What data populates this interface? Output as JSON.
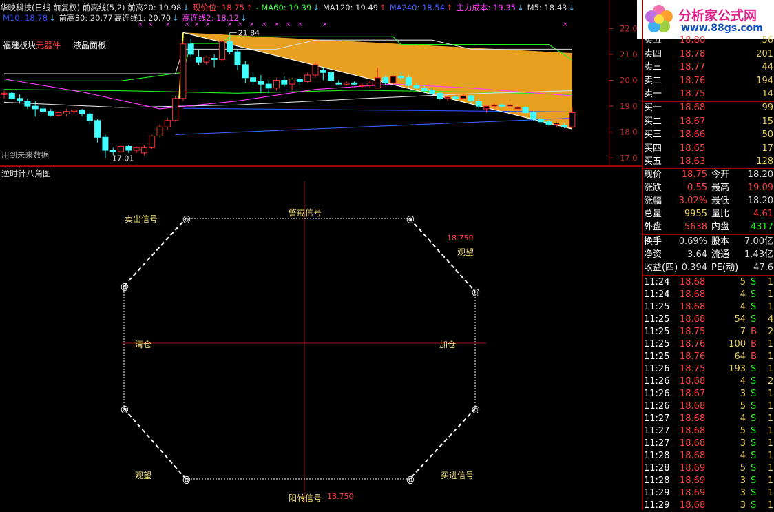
{
  "header": {
    "row1": [
      {
        "text": "华映科技(日线 前复权) 前高线(5,2) 前高20: 19.98",
        "color": "#dddddd"
      },
      {
        "text": "↓",
        "color": "#5fc8ff"
      },
      {
        "text": "现价位: 18.75",
        "color": "#ff4040"
      },
      {
        "text": "↑",
        "color": "#ff4040"
      },
      {
        "text": "- MA60: 19.39",
        "color": "#40ff40"
      },
      {
        "text": "↓",
        "color": "#5fc8ff"
      },
      {
        "text": "MA120: 19.49",
        "color": "#dddddd"
      },
      {
        "text": "↑",
        "color": "#ff4040"
      },
      {
        "text": "MA240: 18.54",
        "color": "#4060ff"
      },
      {
        "text": "↑",
        "color": "#ff4040"
      },
      {
        "text": "主力成本: 19.35",
        "color": "#ff40ff"
      },
      {
        "text": "↓",
        "color": "#5fc8ff"
      },
      {
        "text": "M5: 18.43",
        "color": "#dddddd"
      },
      {
        "text": "↓",
        "color": "#5fc8ff"
      }
    ],
    "row2": [
      {
        "text": "M10: 18.78",
        "color": "#3050ff"
      },
      {
        "text": "↓",
        "color": "#5fc8ff"
      },
      {
        "text": "前高30: 20.77",
        "color": "#dddddd"
      },
      {
        "text": "高连线1: 20.70",
        "color": "#dddddd"
      },
      {
        "text": "↓",
        "color": "#5fc8ff"
      },
      {
        "text": "高连线2: 18.12",
        "color": "#ff40ff"
      },
      {
        "text": "↓",
        "color": "#5fc8ff"
      }
    ],
    "label_block": "福建板块",
    "label_sector": "元器件",
    "label_panel": "液晶面板",
    "label_future": "用到未来数据",
    "high_annotation": "21.84",
    "low_annotation": "17.01",
    "marker_char": "×"
  },
  "logo": {
    "title": "分析家公式网",
    "url": "www.88gs.com"
  },
  "chart_data": [
    {
      "type": "candlestick",
      "title": "",
      "ylim": [
        16.85,
        22.3
      ],
      "y_ticks": [
        "22.00",
        "21.00",
        "20.00",
        "19.00",
        "18.00",
        "17.00"
      ],
      "y_tick_values": [
        22,
        21,
        20,
        19,
        18,
        17
      ],
      "candles": [
        [
          19.45,
          19.6,
          19.3,
          19.5
        ],
        [
          19.5,
          19.55,
          19.25,
          19.3
        ],
        [
          19.3,
          19.45,
          19.1,
          19.2
        ],
        [
          19.2,
          19.3,
          18.9,
          19.0
        ],
        [
          19.0,
          19.2,
          18.6,
          18.9
        ],
        [
          18.9,
          19.0,
          18.7,
          18.8
        ],
        [
          18.8,
          18.9,
          18.6,
          18.65
        ],
        [
          18.65,
          18.8,
          18.6,
          18.75
        ],
        [
          18.7,
          18.9,
          18.6,
          18.8
        ],
        [
          18.8,
          18.9,
          18.7,
          18.85
        ],
        [
          18.85,
          18.9,
          18.6,
          18.7
        ],
        [
          18.7,
          18.8,
          18.3,
          18.45
        ],
        [
          18.45,
          18.5,
          17.6,
          17.8
        ],
        [
          17.8,
          17.9,
          17.0,
          17.3
        ],
        [
          17.3,
          17.4,
          17.1,
          17.25
        ],
        [
          17.25,
          17.5,
          17.2,
          17.45
        ],
        [
          17.45,
          17.5,
          17.2,
          17.3
        ],
        [
          17.3,
          17.45,
          17.2,
          17.4
        ],
        [
          17.2,
          17.5,
          17.1,
          17.4
        ],
        [
          17.4,
          17.9,
          17.35,
          17.85
        ],
        [
          17.85,
          18.3,
          17.8,
          18.2
        ],
        [
          18.2,
          18.55,
          18.1,
          18.45
        ],
        [
          18.45,
          19.4,
          18.4,
          19.3
        ],
        [
          19.3,
          21.5,
          19.2,
          21.4
        ],
        [
          21.4,
          21.6,
          20.9,
          21.0
        ],
        [
          20.9,
          21.2,
          20.6,
          20.7
        ],
        [
          20.7,
          20.95,
          20.6,
          20.9
        ],
        [
          20.85,
          21.0,
          20.5,
          20.8
        ],
        [
          20.8,
          21.6,
          20.7,
          21.5
        ],
        [
          21.5,
          21.84,
          21.0,
          21.1
        ],
        [
          21.1,
          21.2,
          20.4,
          20.6
        ],
        [
          20.6,
          20.75,
          19.9,
          20.1
        ],
        [
          20.1,
          20.3,
          19.8,
          19.95
        ],
        [
          19.95,
          20.2,
          19.5,
          19.85
        ],
        [
          19.85,
          20.0,
          19.5,
          19.7
        ],
        [
          19.7,
          20.1,
          19.6,
          20.0
        ],
        [
          20.0,
          20.15,
          19.75,
          19.85
        ],
        [
          19.85,
          20.1,
          19.6,
          20.05
        ],
        [
          20.05,
          20.1,
          19.8,
          19.95
        ],
        [
          19.95,
          20.3,
          19.9,
          20.2
        ],
        [
          20.2,
          20.7,
          20.1,
          20.6
        ],
        [
          20.4,
          20.5,
          20.0,
          20.3
        ],
        [
          20.3,
          20.35,
          19.9,
          20.0
        ],
        [
          19.9,
          20.0,
          19.8,
          19.85
        ],
        [
          19.85,
          19.95,
          19.8,
          19.9
        ],
        [
          19.9,
          19.95,
          19.8,
          19.85
        ],
        [
          19.8,
          19.9,
          19.7,
          19.8
        ],
        [
          19.8,
          20.0,
          19.7,
          19.9
        ],
        [
          19.7,
          20.5,
          19.7,
          20.1
        ],
        [
          20.1,
          20.2,
          19.8,
          19.9
        ],
        [
          19.9,
          20.2,
          19.8,
          20.15
        ],
        [
          20.15,
          20.3,
          20.0,
          20.1
        ],
        [
          20.1,
          20.2,
          19.7,
          19.8
        ],
        [
          19.8,
          19.9,
          19.65,
          19.7
        ],
        [
          19.7,
          19.8,
          19.5,
          19.6
        ],
        [
          19.6,
          19.7,
          19.4,
          19.5
        ],
        [
          19.5,
          19.55,
          19.25,
          19.3
        ],
        [
          19.3,
          19.4,
          19.2,
          19.35
        ],
        [
          19.35,
          19.4,
          19.25,
          19.3
        ],
        [
          19.3,
          19.45,
          19.25,
          19.4
        ],
        [
          19.4,
          19.45,
          19.1,
          19.2
        ],
        [
          19.2,
          19.3,
          18.9,
          19.0
        ],
        [
          18.9,
          19.05,
          18.75,
          19.0
        ],
        [
          19.0,
          19.1,
          18.9,
          19.05
        ],
        [
          19.05,
          19.1,
          18.95,
          19.0
        ],
        [
          19.0,
          19.1,
          18.9,
          19.05
        ],
        [
          18.9,
          19.0,
          18.9,
          18.95
        ],
        [
          18.95,
          19.0,
          18.7,
          18.75
        ],
        [
          18.75,
          18.8,
          18.45,
          18.5
        ],
        [
          18.5,
          18.55,
          18.3,
          18.4
        ],
        [
          18.4,
          18.45,
          18.25,
          18.3
        ],
        [
          18.3,
          18.4,
          18.2,
          18.35
        ],
        [
          18.25,
          18.35,
          18.15,
          18.2
        ],
        [
          18.2,
          18.95,
          18.15,
          18.75
        ]
      ],
      "lines": [
        {
          "name": "前高20",
          "color": "#22ee22",
          "values": [
            [
              0,
              19.98
            ],
            [
              15,
              19.98
            ],
            [
              23,
              20.3
            ],
            [
              24,
              21.42
            ],
            [
              28,
              21.42
            ],
            [
              29,
              21.68
            ],
            [
              50,
              21.68
            ],
            [
              51,
              21.38
            ],
            [
              70,
              21.38
            ],
            [
              73,
              20.78
            ]
          ]
        },
        {
          "name": "前高30",
          "color": "#dddddd",
          "values": [
            [
              0,
              20.25
            ],
            [
              22,
              20.25
            ],
            [
              23,
              21.2
            ],
            [
              35,
              21.2
            ],
            [
              40,
              21.55
            ],
            [
              55,
              21.55
            ],
            [
              60,
              21.2
            ],
            [
              73,
              21.2
            ]
          ]
        },
        {
          "name": "MA60",
          "color": "#22ee22",
          "values": [
            [
              0,
              19.65
            ],
            [
              15,
              19.6
            ],
            [
              30,
              19.5
            ],
            [
              45,
              19.62
            ],
            [
              60,
              19.55
            ],
            [
              73,
              19.45
            ]
          ]
        },
        {
          "name": "MA120",
          "color": "#dddddd",
          "values": [
            [
              0,
              19.15
            ],
            [
              15,
              18.95
            ],
            [
              30,
              19.05
            ],
            [
              45,
              19.28
            ],
            [
              60,
              19.48
            ],
            [
              73,
              19.6
            ]
          ]
        },
        {
          "name": "主力成本",
          "color": "#ff40ff",
          "values": [
            [
              0,
              20.05
            ],
            [
              10,
              19.55
            ],
            [
              20,
              18.9
            ],
            [
              30,
              19.2
            ],
            [
              40,
              19.65
            ],
            [
              50,
              19.85
            ],
            [
              60,
              19.7
            ],
            [
              73,
              19.4
            ]
          ]
        },
        {
          "name": "MA240",
          "color": "#4060ff",
          "values": [
            [
              22,
              17.9
            ],
            [
              73,
              18.54
            ]
          ]
        },
        {
          "name": "M10",
          "color": "#3050ff",
          "values": [
            [
              23,
              18.92
            ],
            [
              73,
              18.78
            ]
          ]
        },
        {
          "name": "高连线1",
          "color": "#ffffff",
          "values": [
            [
              23,
              21.84
            ],
            [
              73,
              18.12
            ]
          ]
        }
      ],
      "trend_fill": {
        "color": "#e8a020",
        "top": [
          [
            29,
            21.75
          ],
          [
            73,
            21.05
          ]
        ],
        "bottom_from": [
          23,
          21.84
        ],
        "bottom_to": [
          73,
          18.12
        ]
      }
    },
    {
      "type": "octagon-signal",
      "title": "逆时针八角图",
      "labels": {
        "top_left": "卖出信号",
        "top": "警戒信号",
        "right_top": "观望",
        "right": "加仓",
        "bottom_right": "买进信号",
        "bottom": "阳转信号",
        "bottom_left": "观望",
        "left": "清仓"
      },
      "price_right": "18.750",
      "price_bottom": "18.750",
      "vertex_symbol": "@"
    }
  ],
  "quote_panel": {
    "asks": [
      {
        "label": "卖五",
        "price": "18.80",
        "vol": "56"
      },
      {
        "label": "卖四",
        "price": "18.78",
        "vol": "201"
      },
      {
        "label": "卖三",
        "price": "18.77",
        "vol": "44"
      },
      {
        "label": "卖二",
        "price": "18.76",
        "vol": "194"
      },
      {
        "label": "卖一",
        "price": "18.75",
        "vol": "14"
      }
    ],
    "bids": [
      {
        "label": "买一",
        "price": "18.68",
        "vol": "99"
      },
      {
        "label": "买二",
        "price": "18.67",
        "vol": "15"
      },
      {
        "label": "买三",
        "price": "18.66",
        "vol": "50"
      },
      {
        "label": "买四",
        "price": "18.65",
        "vol": "17"
      },
      {
        "label": "买五",
        "price": "18.63",
        "vol": "128"
      }
    ],
    "stats": [
      {
        "l1": "现价",
        "v1": "18.75",
        "c1": "#ff4040",
        "l2": "今开",
        "v2": "18.20",
        "c2": "#dddddd"
      },
      {
        "l1": "涨跌",
        "v1": "0.55",
        "c1": "#ff4040",
        "l2": "最高",
        "v2": "19.09",
        "c2": "#ff4040"
      },
      {
        "l1": "涨幅",
        "v1": "3.02%",
        "c1": "#ff4040",
        "l2": "最低",
        "v2": "18.20",
        "c2": "#dddddd"
      },
      {
        "l1": "总量",
        "v1": "9955",
        "c1": "#e8d060",
        "l2": "量比",
        "v2": "4.61",
        "c2": "#ff4040"
      },
      {
        "l1": "外盘",
        "v1": "5638",
        "c1": "#ff4040",
        "l2": "内盘",
        "v2": "4317",
        "c2": "#22ee22"
      }
    ],
    "stats2": [
      {
        "l1": "换手",
        "v1": "0.69%",
        "l2": "股本",
        "v2": "7.00亿"
      },
      {
        "l1": "净资",
        "v1": "3.64",
        "l2": "流通",
        "v2": "1.43亿"
      },
      {
        "l1": "收益(四)",
        "v1": "0.394",
        "l2": "PE(动)",
        "v2": "47.6"
      }
    ],
    "ticks": [
      {
        "t": "11:24",
        "p": "18.68",
        "v": "5",
        "d": "S",
        "n": "1"
      },
      {
        "t": "11:24",
        "p": "18.68",
        "v": "4",
        "d": "S",
        "n": "1"
      },
      {
        "t": "11:25",
        "p": "18.68",
        "v": "4",
        "d": "S",
        "n": "1"
      },
      {
        "t": "11:25",
        "p": "18.68",
        "v": "54",
        "d": "S",
        "n": "4"
      },
      {
        "t": "11:25",
        "p": "18.75",
        "v": "7",
        "d": "B",
        "n": "2"
      },
      {
        "t": "11:25",
        "p": "18.76",
        "v": "100",
        "d": "B",
        "n": "1"
      },
      {
        "t": "11:25",
        "p": "18.76",
        "v": "64",
        "d": "B",
        "n": "1"
      },
      {
        "t": "11:26",
        "p": "18.75",
        "v": "193",
        "d": "S",
        "n": "1"
      },
      {
        "t": "11:26",
        "p": "18.68",
        "v": "4",
        "d": "S",
        "n": "2"
      },
      {
        "t": "11:26",
        "p": "18.67",
        "v": "3",
        "d": "S",
        "n": "1"
      },
      {
        "t": "11:26",
        "p": "18.68",
        "v": "5",
        "d": "S",
        "n": "1"
      },
      {
        "t": "11:27",
        "p": "18.68",
        "v": "4",
        "d": "S",
        "n": "1"
      },
      {
        "t": "11:27",
        "p": "18.68",
        "v": "5",
        "d": "S",
        "n": "1"
      },
      {
        "t": "11:27",
        "p": "18.68",
        "v": "3",
        "d": "S",
        "n": "1"
      },
      {
        "t": "11:28",
        "p": "18.68",
        "v": "4",
        "d": "S",
        "n": "1"
      },
      {
        "t": "11:28",
        "p": "18.69",
        "v": "5",
        "d": "S",
        "n": "1"
      },
      {
        "t": "11:28",
        "p": "18.69",
        "v": "3",
        "d": "S",
        "n": "1"
      },
      {
        "t": "11:29",
        "p": "18.69",
        "v": "3",
        "d": "S",
        "n": "1"
      },
      {
        "t": "11:29",
        "p": "18.68",
        "v": "3",
        "d": "S",
        "n": "1"
      }
    ]
  }
}
